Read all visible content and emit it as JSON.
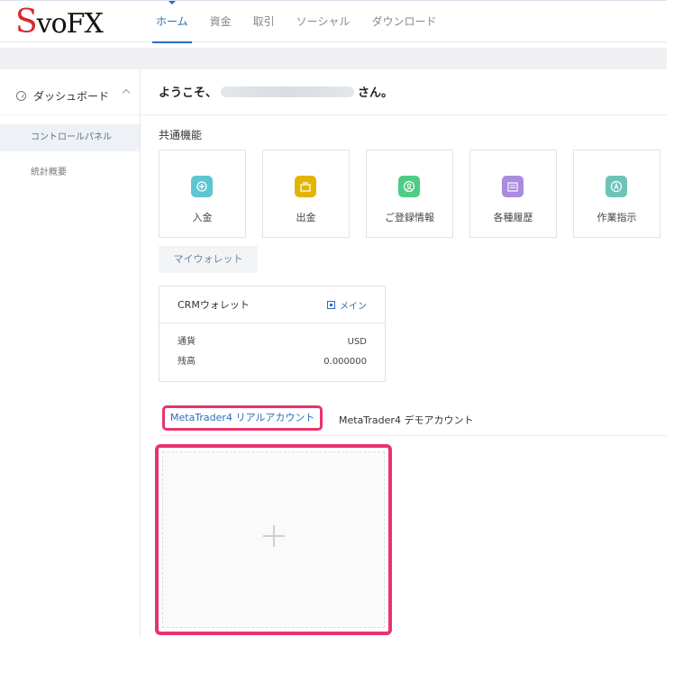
{
  "brand": {
    "logo": "SvoFX"
  },
  "nav": {
    "items": [
      {
        "label": "ホーム",
        "active": true
      },
      {
        "label": "資金",
        "active": false
      },
      {
        "label": "取引",
        "active": false
      },
      {
        "label": "ソーシャル",
        "active": false
      },
      {
        "label": "ダウンロード",
        "active": false
      }
    ]
  },
  "sidebar": {
    "section": {
      "label": "ダッシュボード",
      "icon": "dashboard-icon",
      "expanded": true
    },
    "items": [
      {
        "label": "コントロールパネル",
        "active": true
      },
      {
        "label": "統計概要",
        "active": false
      }
    ]
  },
  "main": {
    "welcome_prefix": "ようこそ、",
    "welcome_suffix": "さん。",
    "section_title": "共通機能",
    "tiles": [
      {
        "label": "入金",
        "icon": "deposit-icon",
        "color": "#5ec5d3"
      },
      {
        "label": "出金",
        "icon": "withdraw-icon",
        "color": "#e2b400"
      },
      {
        "label": "ご登録情報",
        "icon": "profile-icon",
        "color": "#4ecb87"
      },
      {
        "label": "各種履歴",
        "icon": "history-icon",
        "color": "#a98be0"
      },
      {
        "label": "作業指示",
        "icon": "task-icon",
        "color": "#6dc3b6"
      }
    ],
    "wallet_tab": "マイウォレット",
    "crm_wallet": {
      "title": "CRMウォレット",
      "badge": "メイン",
      "rows": [
        {
          "label": "通貨",
          "value": "USD"
        },
        {
          "label": "残高",
          "value": "0.000000"
        }
      ]
    },
    "account_tabs": [
      {
        "label": "MetaTrader4 リアルアカウント",
        "active": true
      },
      {
        "label": "MetaTrader4 デモアカウント",
        "active": false
      }
    ]
  },
  "colors": {
    "accent": "#2a6ebb",
    "highlight": "#e8336e",
    "logo_red": "#d9272d"
  }
}
